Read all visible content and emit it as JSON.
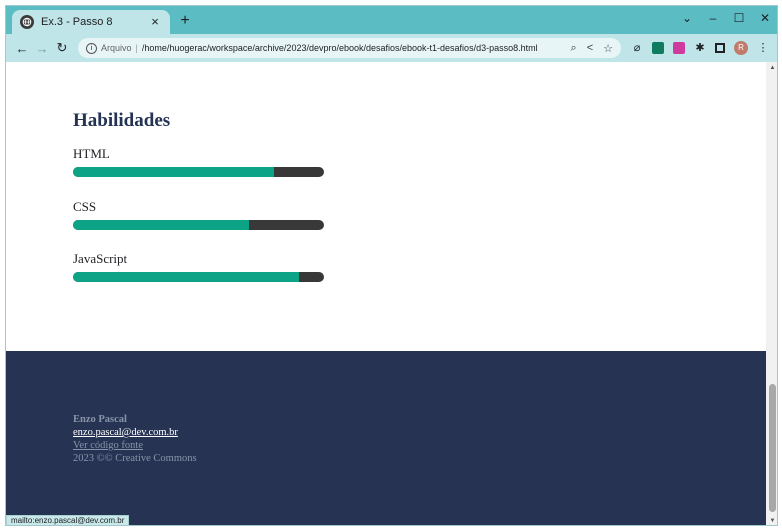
{
  "browser": {
    "tab_title": "Ex.3 - Passo 8",
    "tab_close": "×",
    "new_tab": "+",
    "window_controls": [
      "⌄",
      "–",
      "☐",
      "✕"
    ],
    "nav": {
      "back": "←",
      "forward": "→",
      "reload": "↻"
    },
    "address": {
      "info_label": "Arquivo",
      "separator": "|",
      "url": "/home/huogerac/workspace/archive/2023/devpro/ebook/desafios/ebook-t1-desafios/d3-passo8.html"
    },
    "avatar_letter": "R"
  },
  "skills": {
    "title": "Habilidades",
    "items": [
      {
        "label": "HTML",
        "level": 0.8
      },
      {
        "label": "CSS",
        "level": 0.7
      },
      {
        "label": "JavaScript",
        "level": 0.9
      }
    ]
  },
  "footer": {
    "name": "Enzo Pascal",
    "email": "enzo.pascal@dev.com.br",
    "source_link": "Ver código fonte",
    "copyright": "2023 ©© Creative Commons"
  },
  "status_bar": "mailto:enzo.pascal@dev.com.br",
  "colors": {
    "accent": "#0da386",
    "bar_track": "#383838",
    "footer_bg": "#263353",
    "heading": "#243352",
    "chrome": "#5bbcc4"
  }
}
